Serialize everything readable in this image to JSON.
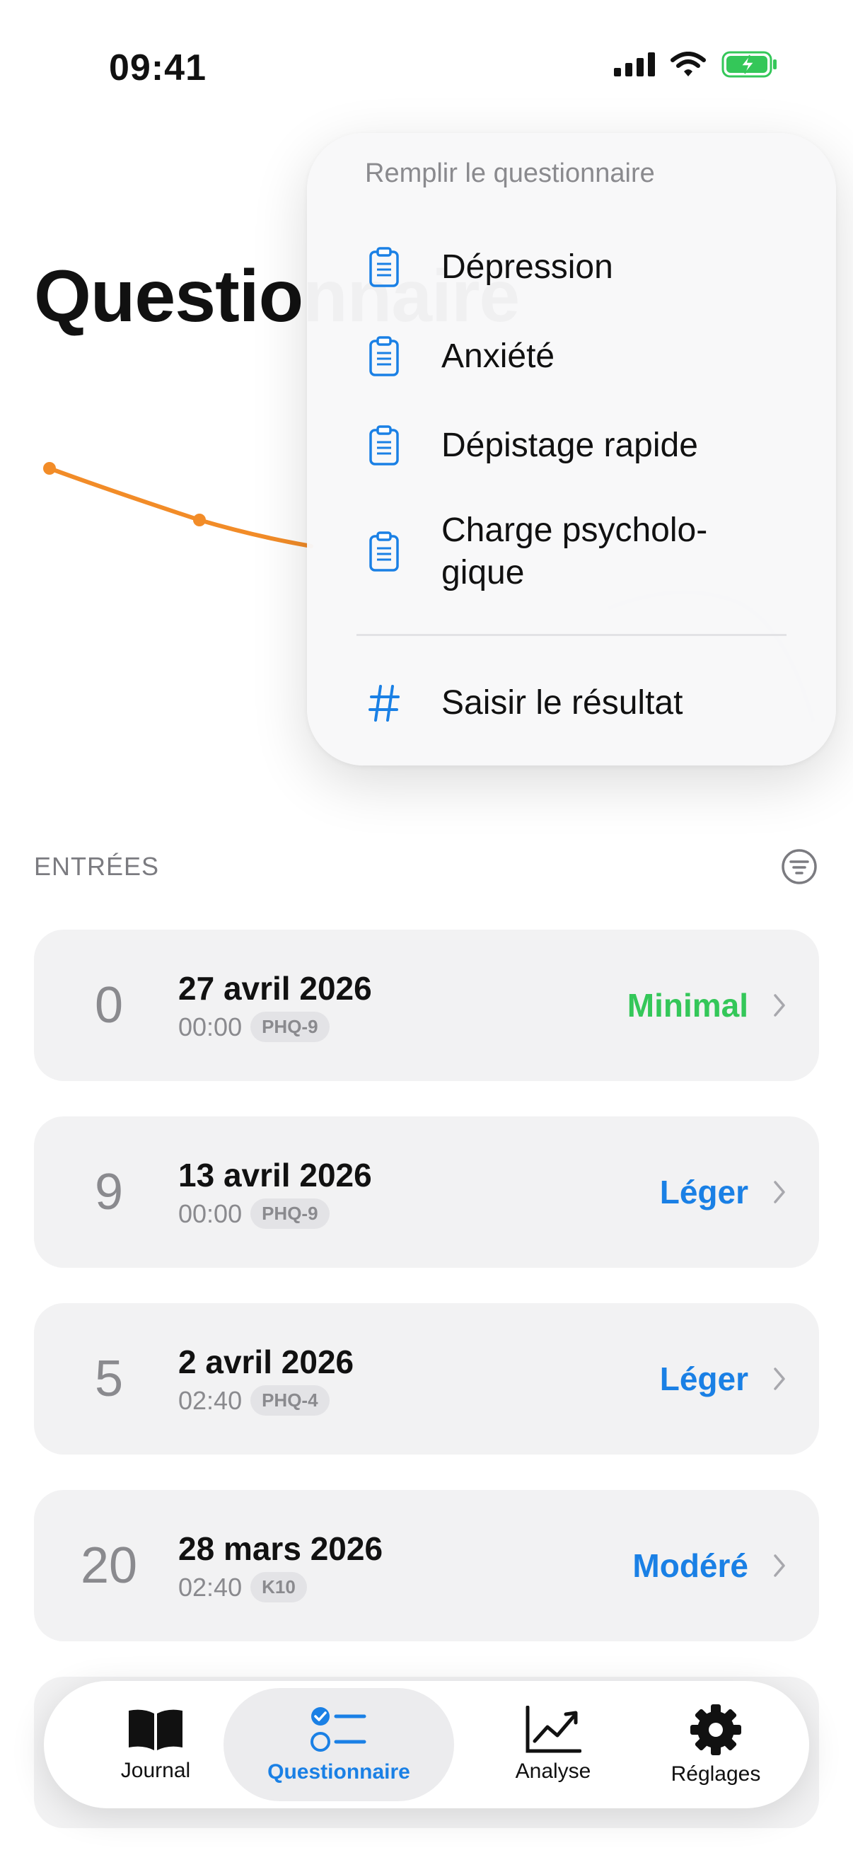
{
  "status_bar": {
    "time": "09:41"
  },
  "page": {
    "title": "Questionnaire"
  },
  "colors": {
    "accent": "#1a80e5",
    "chart_line": "#f28c28",
    "minimal": "#34c759",
    "moderate": "#1a80e5"
  },
  "section": {
    "title": "ENTRÉES"
  },
  "menu": {
    "header": "Remplir le questionnaire",
    "items": [
      {
        "label": "Dépression",
        "icon": "clipboard-icon"
      },
      {
        "label": "Anxiété",
        "icon": "clipboard-icon"
      },
      {
        "label": "Dépistage rapide",
        "icon": "clipboard-icon"
      },
      {
        "label_line1": "Charge psycholo-",
        "label_line2": "gique",
        "icon": "clipboard-icon"
      }
    ],
    "enter_result": {
      "label": "Saisir le résultat",
      "icon": "hash-icon"
    }
  },
  "entries": [
    {
      "score": "0",
      "date": "27 avril 2026",
      "time": "00:00",
      "badge": "PHQ-9",
      "severity": "Minimal",
      "severity_color": "#34c759"
    },
    {
      "score": "9",
      "date": "13 avril 2026",
      "time": "00:00",
      "badge": "PHQ-9",
      "severity": "Léger",
      "severity_color": "#1a80e5"
    },
    {
      "score": "5",
      "date": "2 avril 2026",
      "time": "02:40",
      "badge": "PHQ-4",
      "severity": "Léger",
      "severity_color": "#1a80e5"
    },
    {
      "score": "20",
      "date": "28 mars 2026",
      "time": "02:40",
      "badge": "K10",
      "severity": "Modéré",
      "severity_color": "#1a80e5"
    }
  ],
  "tabs": [
    {
      "label": "Journal",
      "icon": "book-icon"
    },
    {
      "label": "Questionnaire",
      "icon": "checklist-icon",
      "active": true
    },
    {
      "label": "Analyse",
      "icon": "chart-icon"
    },
    {
      "label": "Réglages",
      "icon": "gear-icon"
    }
  ]
}
